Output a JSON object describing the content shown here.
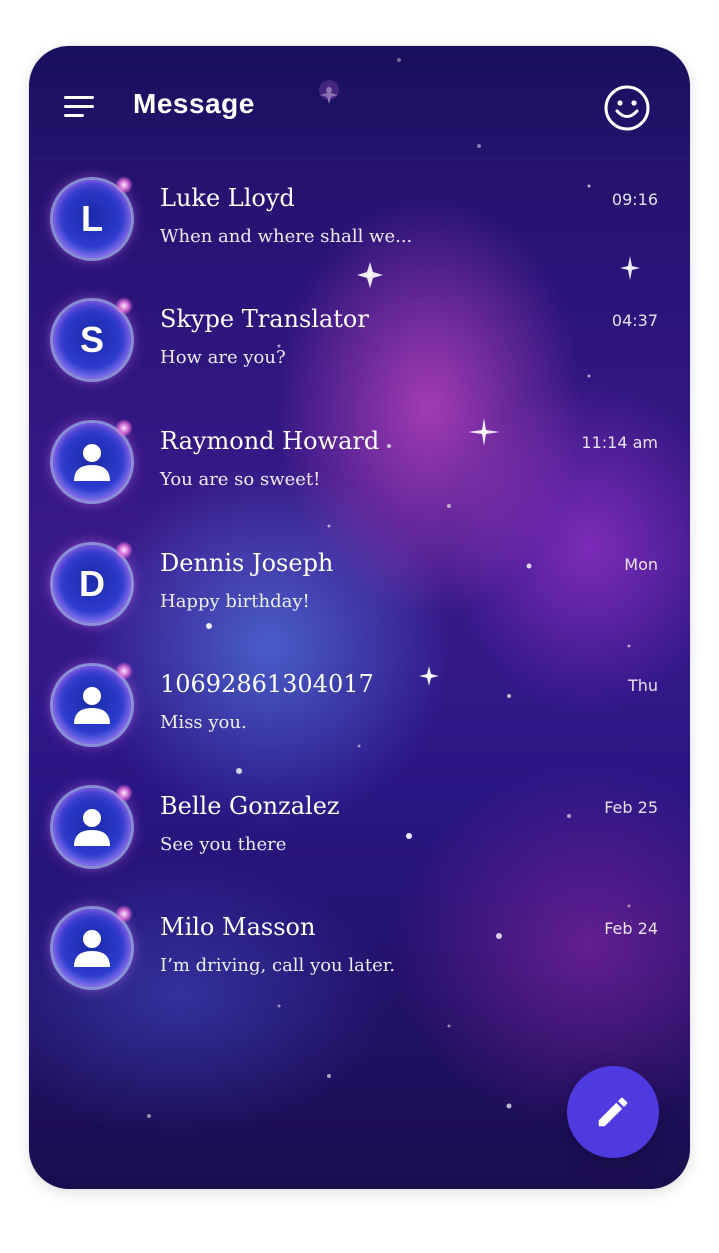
{
  "header": {
    "title": "Message",
    "menu_icon": "hamburger-menu-icon",
    "emoji_icon": "smiley-face-icon"
  },
  "conversations": [
    {
      "name": "Luke Lloyd",
      "preview": "When and where shall we...",
      "time": "09:16",
      "avatar_type": "letter",
      "avatar_letter": "L"
    },
    {
      "name": "Skype Translator",
      "preview": "How are you?",
      "time": "04:37",
      "avatar_type": "letter",
      "avatar_letter": "S"
    },
    {
      "name": "Raymond Howard",
      "preview": "You are so sweet!",
      "time": "11:14 am",
      "avatar_type": "person-icon"
    },
    {
      "name": "Dennis Joseph",
      "preview": "Happy birthday!",
      "time": "Mon",
      "avatar_type": "letter",
      "avatar_letter": "D"
    },
    {
      "name": "10692861304017",
      "preview": "Miss you.",
      "time": "Thu",
      "avatar_type": "person-icon"
    },
    {
      "name": "Belle Gonzalez",
      "preview": "See you there",
      "time": "Feb 25",
      "avatar_type": "person-icon"
    },
    {
      "name": "Milo Masson",
      "preview": "I’m driving, call you later.",
      "time": "Feb 24",
      "avatar_type": "person-icon"
    }
  ],
  "compose_button": {
    "icon": "pencil-icon"
  },
  "colors": {
    "accent": "#4f3ae0",
    "background_top": "#1e1160",
    "background_bottom": "#1a0d4e",
    "text": "#ffffff"
  }
}
